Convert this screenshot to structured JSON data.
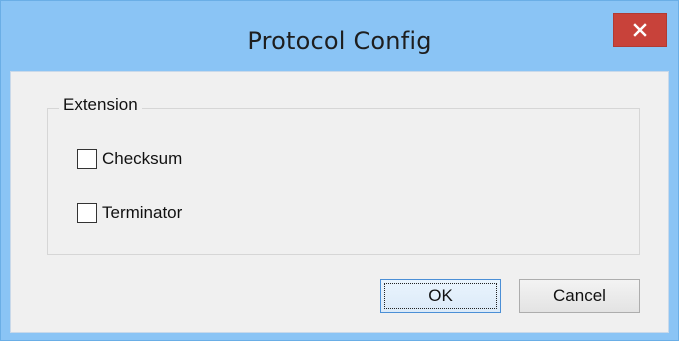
{
  "window": {
    "title": "Protocol Config",
    "close_glyph": "✕"
  },
  "groupbox": {
    "legend": "Extension",
    "checkboxes": [
      {
        "label": "Checksum",
        "checked": false
      },
      {
        "label": "Terminator",
        "checked": false
      }
    ]
  },
  "buttons": {
    "ok_label": "OK",
    "cancel_label": "Cancel"
  },
  "colors": {
    "titlebar": "#8ac4f5",
    "close_button": "#c8423a",
    "client_background": "#f0f0f0"
  },
  "icons": {
    "close": "close-icon"
  }
}
